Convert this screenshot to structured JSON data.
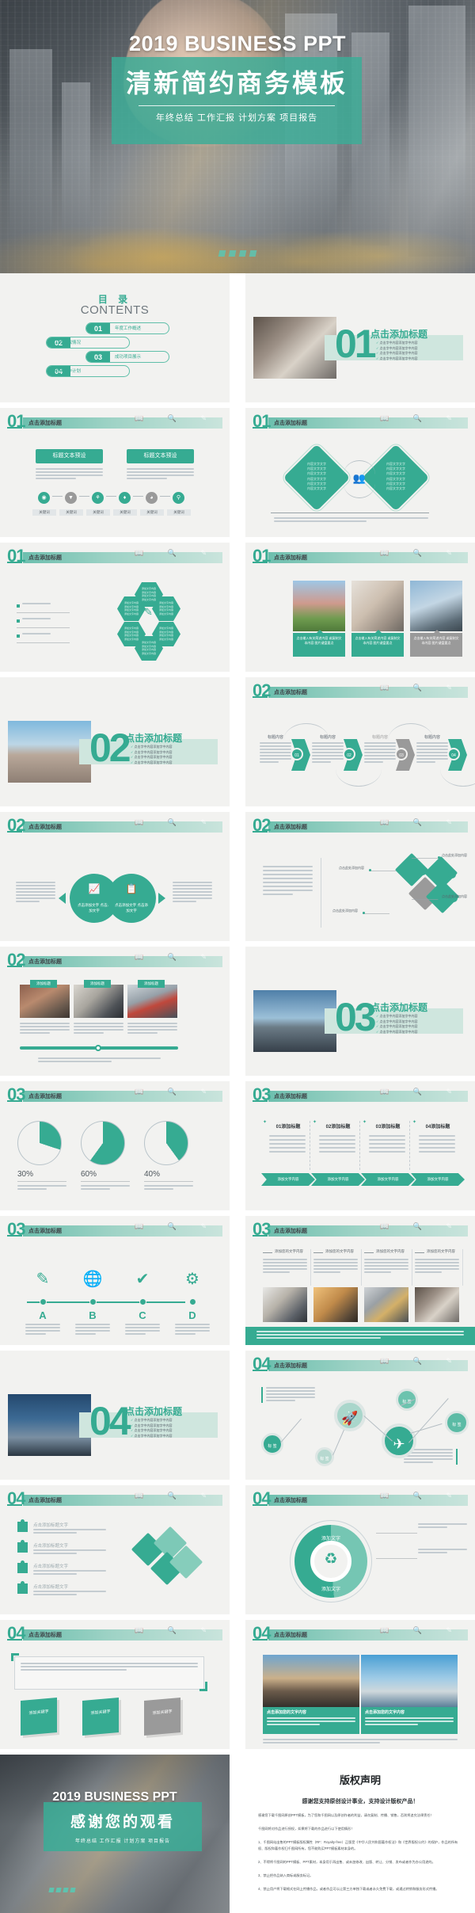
{
  "cover": {
    "title_en": "2019 BUSINESS PPT",
    "title_cn": "清新简约商务模板",
    "tags": "年终总结  工作汇报  计划方案  项目报告"
  },
  "contents": {
    "title_cn": "目  录",
    "title_en": "CONTENTS",
    "items": [
      {
        "num": "01",
        "label": "年度工作概述",
        "side": "right"
      },
      {
        "num": "02",
        "label": "工作完成情况",
        "side": "left"
      },
      {
        "num": "03",
        "label": "成功项目展示",
        "side": "right"
      },
      {
        "num": "04",
        "label": "明年工作计划",
        "side": "left"
      }
    ]
  },
  "common": {
    "slide_title": "点击添加标题",
    "add_text": "点击添加文字",
    "add_content": "点击此处添加内容",
    "body_placeholder": "点击添加文字内容点击添加文字内容",
    "title_preset": "标题文本预设",
    "keyword": "关键词",
    "content_title": "标题内容",
    "add_title_text": "点击添加标题文字",
    "add_text_content": "添加文字内容",
    "input_text": "输入您的文字输入您的文字 输入您的文字 输入您的文字 输入您的文字 输入您的文字"
  },
  "slides": [
    {
      "id": "s01-intro",
      "num": "01",
      "title": "点击添加标题",
      "type": "divider",
      "big": "01",
      "bullets": [
        "点击字中内容添加字中内容",
        "点击字中内容添加字中内容",
        "点击字中内容添加字中内容",
        "点击字中内容添加字中内容"
      ]
    },
    {
      "id": "s02-two-box",
      "num": "01",
      "title": "点击添加标题",
      "type": "two-box",
      "boxes": [
        "标题文本预设",
        "标题文本预设"
      ],
      "desc": "此部分内容作为文字排版占位显示（建议使用主题字体）如需修改请点击【在线编辑】修改模板中的文字内容。",
      "chips": [
        "关键词",
        "关键词",
        "关键词",
        "关键词",
        "关键词",
        "关键词"
      ]
    },
    {
      "id": "s03-diamond",
      "num": "01",
      "title": "点击添加标题",
      "type": "diamond",
      "diamond_text": "内容文字文字",
      "footer": "内容文字文字内容文字文字内容文字文字内容文字文字内容文字文字内容文字文字"
    },
    {
      "id": "s04-hex",
      "num": "01",
      "title": "点击添加标题",
      "type": "hex",
      "bullets": [
        "点击此处输入文字点击此处输入文字点击此处输入",
        "点击此处输入文字点击此处输入文字点击此处输入",
        "点击此处输入文字点击此处输入文字点击此处输入"
      ],
      "hex_text": "添加文字内容"
    },
    {
      "id": "s05-photos3",
      "num": "01",
      "title": "点击添加标题",
      "type": "photos3",
      "caption": "点击输入有关简述内容 或复制文本内容 图片键盘要点"
    },
    {
      "id": "s06-sec2",
      "num": "02",
      "title": "点击添加标题",
      "type": "divider",
      "big": "02",
      "bullets": [
        "点击字中内容添加字中内容",
        "点击字中内容添加字中内容",
        "点击字中内容添加字中内容",
        "点击字中内容添加字中内容"
      ]
    },
    {
      "id": "s07-chev",
      "num": "02",
      "title": "点击添加标题",
      "type": "chevron",
      "steps": [
        {
          "n": "01",
          "t": "标题内容",
          "d": "我们从来为客户提供专业的开发设计、运营服务等全程服务，完善企业优质的专业化的国际服务为客户提供优质的的服务。"
        },
        {
          "n": "02",
          "t": "标题内容",
          "d": "我们从来为客户提供专业的开发设计、运营服务等全程服务，完善企业优质的专业化的国际服务为客户提供优质的的服务。"
        },
        {
          "n": "03",
          "t": "标题内容",
          "d": "我们从来为客户提供专业的开发设计、运营服务等全程服务，完善企业优质的专业化的国际服务为客户提供优质的的服务。"
        },
        {
          "n": "04",
          "t": "标题内容",
          "d": "我们从来为客户提供专业的开发设计、运营服务等全程服务，完善企业优质的专业化的国际服务为客户提供优质的的服务。"
        }
      ]
    },
    {
      "id": "s08-circles",
      "num": "02",
      "title": "点击添加标题",
      "type": "circles",
      "left_text": "内容文字文字内容文字文字",
      "right_text": "内容文字文字内容文字文字",
      "circle_labels": [
        "点击添加文字 点击添加文字",
        "点击添加文字 点击添加文字"
      ]
    },
    {
      "id": "s09-puzzle",
      "num": "02",
      "title": "点击添加标题",
      "type": "puzzle",
      "left_block": "点击添加文字内容点击添加文字内容点击添加文字内容",
      "labels": [
        "点击此处添加内容",
        "点击此处添加内容",
        "点击此处添加内容",
        "点击此处添加内容"
      ]
    },
    {
      "id": "s10-photos3b",
      "num": "02",
      "title": "点击添加标题",
      "type": "photos3b",
      "tabs": [
        "添加标题",
        "添加标题",
        "添加标题"
      ],
      "caption": "这里可输入正文内容，或粘贴您的内容文字。可以复制您的内容，并修改为您需要的文字。",
      "footer": "这里可输入正文内容，或粘贴您的内容文字。可以复制您的内容，并修改为您需要的文字。"
    },
    {
      "id": "s11-sec3",
      "num": "03",
      "title": "点击添加标题",
      "type": "divider",
      "big": "03",
      "bullets": [
        "点击字中内容添加字中内容",
        "点击字中内容添加字中内容",
        "点击字中内容添加字中内容",
        "点击字中内容添加字中内容"
      ]
    },
    {
      "id": "s12-pies",
      "num": "03",
      "title": "点击添加标题",
      "type": "pies",
      "desc": "点击此处输入文字点击此处输入文字点击此处输入文字点击此处输入文字"
    },
    {
      "id": "s13-columns",
      "num": "03",
      "title": "点击添加标题",
      "type": "columns",
      "cols": [
        "01添加标题",
        "02添加标题",
        "03添加标题",
        "04添加标题"
      ],
      "col_lines": [
        "添加文字内容",
        "添加文字内容",
        "添加文字内容",
        "添加文字内容",
        "添加文字内容"
      ],
      "arrows": [
        "添加文字内容",
        "添加文字内容",
        "添加文字内容",
        "添加文字内容"
      ]
    },
    {
      "id": "s14-icons",
      "num": "03",
      "title": "点击添加标题",
      "type": "icons",
      "letters": [
        "A",
        "B",
        "C",
        "D"
      ],
      "icons": [
        "pencil-icon",
        "globe-icon",
        "check-icon",
        "gear-icon"
      ],
      "desc": "内容文字文字内容文字文字内容文字文字内容文字文字"
    },
    {
      "id": "s15-photos4",
      "num": "03",
      "title": "点击添加标题",
      "type": "photos4",
      "heads": [
        "添加您的文字内容",
        "添加您的文字内容",
        "添加您的文字内容",
        "添加您的文字内容"
      ],
      "desc": "输入您的文字，点击添加您的内容，请在此处输入您的内容文字，点击此处添加您的内容文字。",
      "band": "输入您的文字，点击添加您的内容文字，请在此处输入您的内容文字。"
    },
    {
      "id": "s16-sec4",
      "num": "04",
      "title": "点击添加标题",
      "type": "divider",
      "big": "04",
      "bullets": [
        "点击字中内容添加字中内容",
        "点击字中内容添加字中内容",
        "点击字中内容添加字中内容",
        "点击字中内容添加字中内容"
      ]
    },
    {
      "id": "s17-network",
      "num": "04",
      "title": "点击添加标题",
      "type": "network",
      "node_label": "标 签",
      "text_top": "输入您的文字输入您的文字 输入您的文字 输入您的文字 输入您的文字 输入您的文字",
      "text_bottom": "输入您的文字输入您的文字 输入您的文字 输入您的文字 输入您的文字 输入您的文字",
      "icons": [
        "rocket-icon",
        "plane-icon"
      ]
    },
    {
      "id": "s18-puzzlelist",
      "num": "04",
      "title": "点击添加标题",
      "type": "puzzlelist",
      "items": [
        {
          "t": "点击添加标题文字",
          "d": "点击添加文字内容点击添加文字内容点击添加文字内容"
        },
        {
          "t": "点击添加标题文字",
          "d": "点击添加文字内容点击添加文字内容点击添加文字内容"
        },
        {
          "t": "点击添加标题文字",
          "d": "点击添加文字内容点击添加文字内容点击添加文字内容"
        },
        {
          "t": "点击添加标题文字",
          "d": "点击添加文字内容点击添加文字内容点击添加文字内容"
        }
      ]
    },
    {
      "id": "s19-donut",
      "num": "04",
      "title": "点击添加标题",
      "type": "donut",
      "donut_labels": [
        "添加文字",
        "添加文字"
      ],
      "notes": [
        "点击此处输入文字点击此处输入文字",
        "点击此处输入文字点击此处输入文字"
      ],
      "icon": "recycle-icon"
    },
    {
      "id": "s20-cards",
      "num": "04",
      "title": "点击添加标题",
      "type": "cards",
      "box_text": "写作者…… 此处输入您的文字，请在此处复制您的内容，点击此处添加  请粘贴您的内容并修改内容，写作者……",
      "cards": [
        "添加关键字",
        "添加关键字",
        "添加关键字"
      ]
    },
    {
      "id": "s21-photos2",
      "num": "04",
      "title": "点击添加标题",
      "type": "photos2",
      "heads": [
        "点击添加您的文字内容",
        "点击添加您的文字内容"
      ],
      "desc": "点击此处输入文字内容，点击此处输入文字内容，点击此处输入文字内容。"
    }
  ],
  "ending": {
    "title_en": "2019 BUSINESS PPT",
    "title_cn": "感谢您的观看",
    "tags": "年终总结 工作汇报 计划方案 项目报告"
  },
  "copyright": {
    "heading": "版权声明",
    "sub": "感谢您支持原创设计事业，支持设计版权产品！",
    "p1": "感谢您下载千图网原创PPT模板，为了您和千图网以及原创作者的利益，请勿复制、传播、销售，否则将追究法律责任！",
    "p2": "千图网将对作品进行授权，如果将下载的作品进行以下使用情形！",
    "p3": "1、千图网站出售的PPT模板版权属性（RF：Royalty-free）正版受《中华人民共和国著作权法》和《世界版权公约》的保护，作品的所有权、版权和著作权归千图网所有，您不能购买PPT模板素材本身的。",
    "p4": "2、不得将千图网的PPT模板、PPT素材，本身用于再出售、或未加修改、出版、转让、分销、发布或者作为办公用途的。",
    "p5": "3、禁止把作品纳入商标或服务标记。",
    "p6": "4、禁止用户将下载格式在网上传播作品，或者作品可以让第三方单独下载或者永久免费下载，或通过转销和服务形式传播。"
  },
  "colors": {
    "accent": "#36ab92",
    "accent_light": "#9fd3c6",
    "bg": "#f2f2f0",
    "gray": "#9a9a9a"
  }
}
